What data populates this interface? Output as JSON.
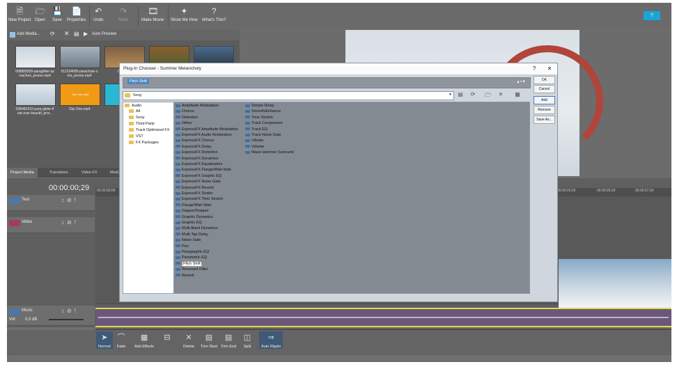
{
  "toolbar": {
    "items": [
      "New Project",
      "Open",
      "Save",
      "Properties",
      "Undo",
      "Redo",
      "Make Movie",
      "Show Me How",
      "What's This?"
    ],
    "help_label": "?"
  },
  "media": {
    "toolbar_items": [
      "Add Media...",
      "Auto Preview"
    ],
    "clips": [
      "008880939-paraglider-sp roaches_prores.mp4",
      "011224695-parachute-s mo_prores.mp4",
      "01270...",
      "",
      "",
      "038481910-para-glider-fl oat-over-beautif_pror...",
      "Clip One.mp4",
      "Cl..."
    ],
    "orange_clip_text": "Clip One.mp4"
  },
  "panel_tabs": [
    "Project Media",
    "Transitions",
    "Video FX",
    "Medi..."
  ],
  "timeline": {
    "timecode": "00:00:00;29",
    "ruler_marks": [
      "00:00:00;00",
      "00:00:23;29",
      "00:00:25;29",
      "00:00:27;29"
    ],
    "tracks": [
      {
        "name": "Text"
      },
      {
        "name": "Video"
      },
      {
        "name": "Music"
      }
    ],
    "vol_label": "Vol:",
    "vol_value": "0,0 dB"
  },
  "bottom_tools": [
    "Normal",
    "Fade",
    "Add Effects",
    "Delete",
    "Trim Start",
    "Trim End",
    "Split",
    "Auto Ripple"
  ],
  "dialog": {
    "title": "Plug-In Chooser - Summer Melancholy",
    "chain_selected": "Pitch Shift",
    "address": "Sony",
    "buttons": [
      "OK",
      "Cancel",
      "Add",
      "Remove",
      "Save As..."
    ],
    "tree": [
      "Audio",
      "All",
      "Sony",
      "Third Party",
      "Track Optimized FX",
      "VST",
      "FX Packages"
    ],
    "plugins_col1": [
      "Amplitude Modulation",
      "Chorus",
      "Distortion",
      "Dither",
      "ExpressFX Amplitude Modulation",
      "ExpressFX Audio Restoration",
      "ExpressFX Chorus",
      "ExpressFX Delay",
      "ExpressFX Distortion",
      "ExpressFX Dynamics",
      "ExpressFX Equalization",
      "ExpressFX Flange/Wah-Wah",
      "ExpressFX Graphic EQ",
      "ExpressFX Noise Gate",
      "ExpressFX Reverb",
      "ExpressFX Stutter",
      "ExpressFX Time Stretch",
      "Flange/Wah-Wah",
      "Gapper/Snipper",
      "Graphic Dynamics",
      "Graphic EQ",
      "Multi-Band Dynamics",
      "Multi-Tap Delay",
      "Noise Gate",
      "Pan",
      "Paragraphic EQ",
      "Parametric EQ",
      "Pitch Shift",
      "Resonant Filter",
      "Reverb"
    ],
    "plugins_col2": [
      "Simple Delay",
      "Smooth/Enhance",
      "Time Stretch",
      "Track Compressor",
      "Track EQ",
      "Track Noise Gate",
      "Vibrato",
      "Volume",
      "Wave Hammer Surround"
    ],
    "selected_plugin": "Pitch Shift"
  },
  "colors": {
    "accent": "#1aa5d8",
    "selection": "#4d86c2",
    "music_track": "#6a577a"
  }
}
